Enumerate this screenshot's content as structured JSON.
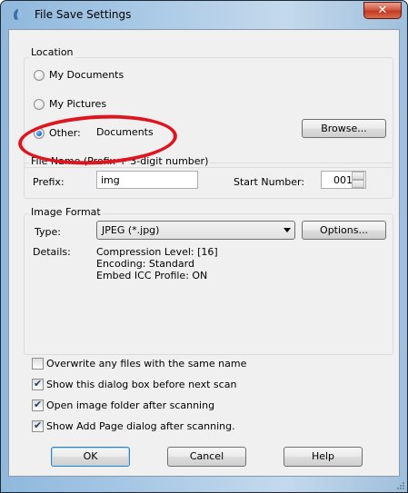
{
  "window": {
    "title": "File Save Settings",
    "close_glyph": "✕"
  },
  "location": {
    "label": "Location",
    "my_documents": "My Documents",
    "my_pictures": "My Pictures",
    "other": "Other:",
    "other_path": "Documents",
    "selected": "other",
    "browse": "Browse..."
  },
  "file_name": {
    "label": "File Name (Prefix + 3-digit number)",
    "prefix_label": "Prefix:",
    "prefix_value": "img",
    "start_label": "Start Number:",
    "start_value": "001"
  },
  "image_format": {
    "label": "Image Format",
    "type_label": "Type:",
    "type_value": "JPEG (*.jpg)",
    "options": "Options...",
    "details_label": "Details:",
    "details": [
      "Compression Level: [16]",
      "Encoding: Standard",
      "Embed ICC Profile: ON"
    ]
  },
  "checkboxes": [
    {
      "label": "Overwrite any files with the same name",
      "checked": false
    },
    {
      "label": "Show this dialog box before next scan",
      "checked": true
    },
    {
      "label": "Open image folder after scanning",
      "checked": true
    },
    {
      "label": "Show Add Page dialog after scanning.",
      "checked": true
    }
  ],
  "buttons": {
    "ok": "OK",
    "cancel": "Cancel",
    "help": "Help"
  },
  "annotation": {
    "color": "#e0141f"
  }
}
